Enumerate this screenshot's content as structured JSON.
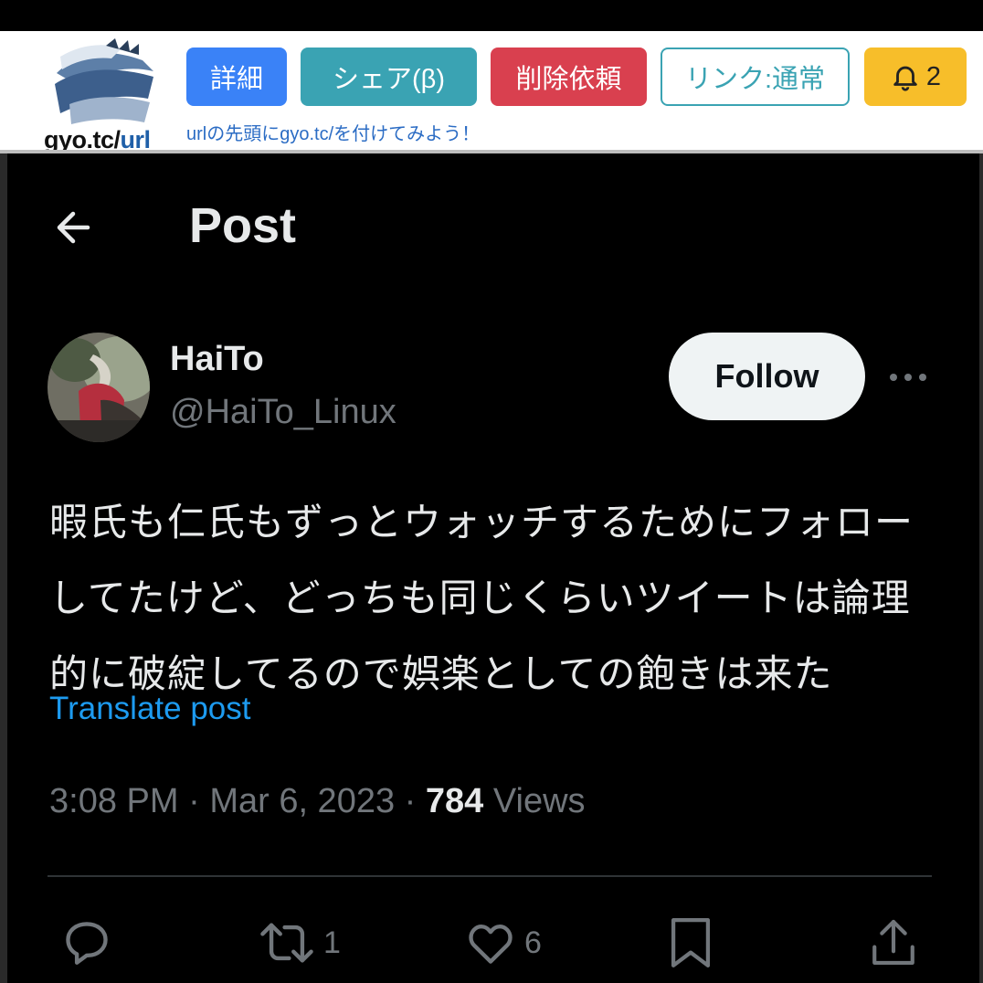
{
  "gyo": {
    "logo_main": "gyo.tc/",
    "logo_accent": "url",
    "buttons": {
      "detail": "詳細",
      "share": "シェア(β)",
      "delete": "削除依頼",
      "link": "リンク:通常",
      "bell_count": "2"
    },
    "hint": "urlの先頭にgyo.tc/を付けてみよう！"
  },
  "header": {
    "title": "Post"
  },
  "author": {
    "name": "HaiTo",
    "handle": "@HaiTo_Linux"
  },
  "follow_label": "Follow",
  "post": {
    "lines": [
      "暇氏も仁氏もずっとウォッチするためにフォロー",
      "してたけど、どっちも同じくらいツイートは論理",
      "的に破綻してるので娯楽としての飽きは来た"
    ],
    "translate_label": "Translate post"
  },
  "meta": {
    "time": "3:08 PM",
    "separator": "·",
    "date": "Mar 6, 2023",
    "views_count": "784",
    "views_label": "Views"
  },
  "actions": {
    "reposts": "1",
    "likes": "6"
  },
  "colors": {
    "accent": "#1d9bf0",
    "text": "#e7e9ea",
    "muted": "#71767b",
    "follow_bg": "#eff3f4"
  }
}
